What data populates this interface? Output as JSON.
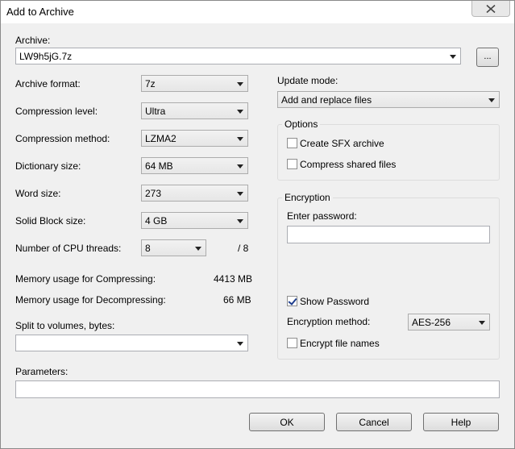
{
  "window": {
    "title": "Add to Archive"
  },
  "archive": {
    "label": "Archive:",
    "value": "LW9h5jG.7z",
    "browse_label": "..."
  },
  "left": {
    "format": {
      "label": "Archive format:",
      "value": "7z"
    },
    "level": {
      "label": "Compression level:",
      "value": "Ultra"
    },
    "method": {
      "label": "Compression method:",
      "value": "LZMA2"
    },
    "dict": {
      "label": "Dictionary size:",
      "value": "64 MB"
    },
    "word": {
      "label": "Word size:",
      "value": "273"
    },
    "solid": {
      "label": "Solid Block size:",
      "value": "4 GB"
    },
    "threads": {
      "label": "Number of CPU threads:",
      "value": "8",
      "max": "/ 8"
    },
    "mem_comp": {
      "label": "Memory usage for Compressing:",
      "value": "4413 MB"
    },
    "mem_decomp": {
      "label": "Memory usage for Decompressing:",
      "value": "66 MB"
    },
    "split": {
      "label": "Split to volumes, bytes:",
      "value": ""
    }
  },
  "parameters": {
    "label": "Parameters:",
    "value": ""
  },
  "right": {
    "update": {
      "label": "Update mode:",
      "value": "Add and replace files"
    },
    "options": {
      "title": "Options",
      "sfx": {
        "label": "Create SFX archive",
        "checked": false
      },
      "shared": {
        "label": "Compress shared files",
        "checked": false
      }
    },
    "encryption": {
      "title": "Encryption",
      "password_label": "Enter password:",
      "password_value": "",
      "show_password": {
        "label": "Show Password",
        "checked": true
      },
      "method_label": "Encryption method:",
      "method_value": "AES-256",
      "encrypt_names": {
        "label": "Encrypt file names",
        "checked": false
      }
    }
  },
  "buttons": {
    "ok": "OK",
    "cancel": "Cancel",
    "help": "Help"
  },
  "icons": {
    "close": "close-icon",
    "dropdown": "chevron-down-icon"
  }
}
